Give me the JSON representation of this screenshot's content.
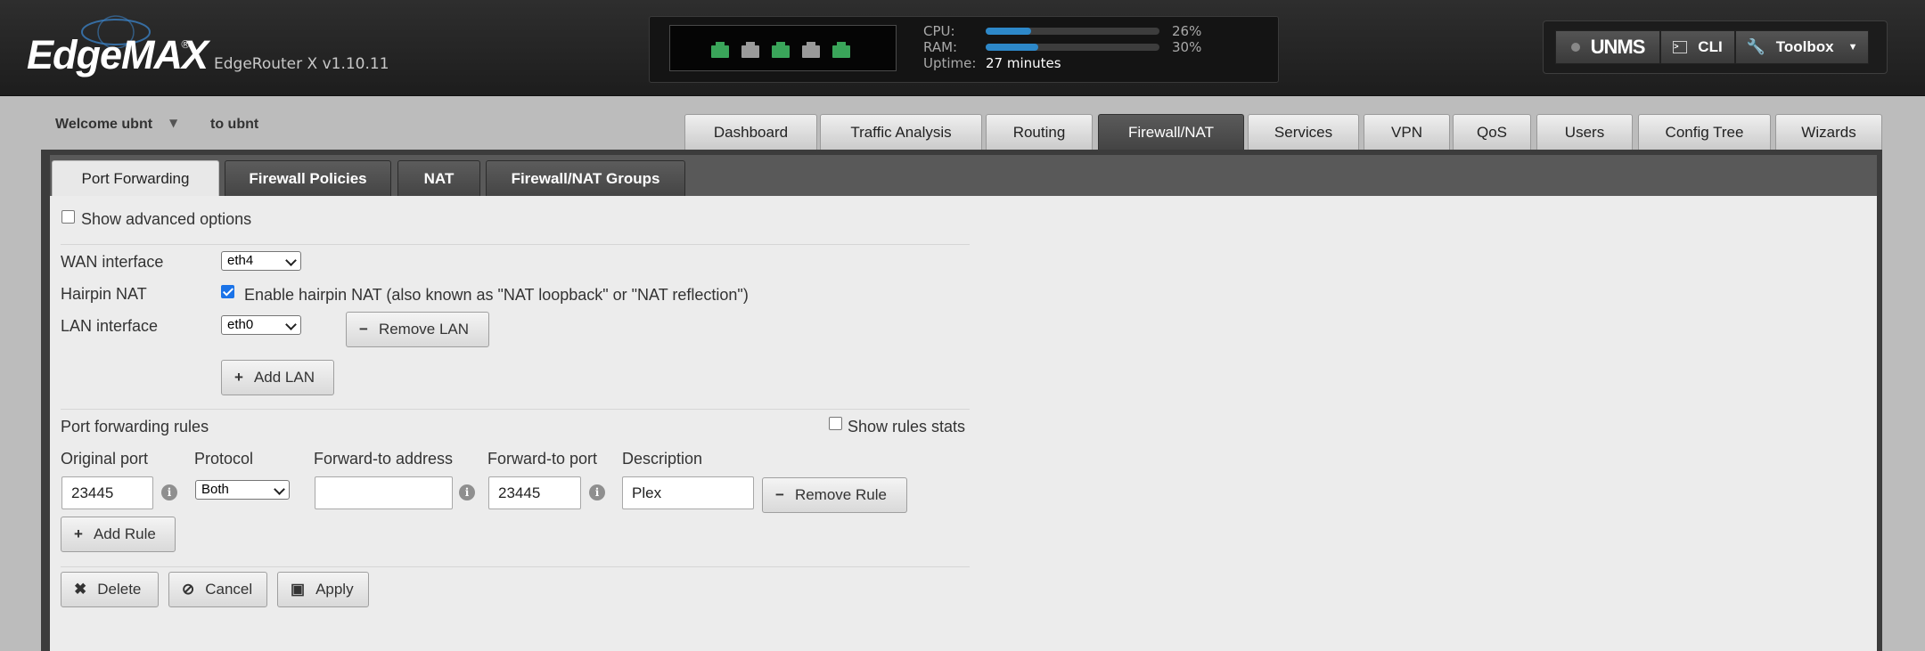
{
  "header": {
    "logo": "EdgeMAX",
    "logo_tm": "®",
    "version": "EdgeRouter X v1.10.11",
    "ports": [
      {
        "name": "port-0",
        "color": "#3aa55a"
      },
      {
        "name": "port-1",
        "color": "#9a9a9a"
      },
      {
        "name": "port-2",
        "color": "#3aa55a"
      },
      {
        "name": "port-3",
        "color": "#9a9a9a"
      },
      {
        "name": "port-4",
        "color": "#3aa55a"
      }
    ],
    "cpu_label": "CPU:",
    "cpu_value": "26%",
    "cpu_fraction": 0.26,
    "ram_label": "RAM:",
    "ram_value": "30%",
    "ram_fraction": 0.3,
    "uptime_label": "Uptime:",
    "uptime_value": "27 minutes",
    "unms_label": "UNMS",
    "cli_label": "CLI",
    "toolbox_label": "Toolbox"
  },
  "user": {
    "welcome": "Welcome ubnt",
    "to_user": "to ubnt"
  },
  "nav": {
    "tabs": [
      "Dashboard",
      "Traffic Analysis",
      "Routing",
      "Firewall/NAT",
      "Services",
      "VPN",
      "QoS",
      "Users",
      "Config Tree",
      "Wizards"
    ],
    "active": "Firewall/NAT"
  },
  "subnav": {
    "tabs": [
      "Port Forwarding",
      "Firewall Policies",
      "NAT",
      "Firewall/NAT Groups"
    ],
    "active": "Port Forwarding"
  },
  "form": {
    "show_advanced": "Show advanced options",
    "wan_label": "WAN interface",
    "wan_value": "eth4",
    "hairpin_label": "Hairpin NAT",
    "hairpin_text": "Enable hairpin NAT (also known as \"NAT loopback\" or \"NAT reflection\")",
    "hairpin_checked": true,
    "lan_label": "LAN interface",
    "lan_value": "eth0",
    "remove_lan": "Remove LAN",
    "add_lan": "Add LAN",
    "rules_label": "Port forwarding rules",
    "show_rules_stats": "Show rules stats",
    "col_original_port": "Original port",
    "col_protocol": "Protocol",
    "col_forward_address": "Forward-to address",
    "col_forward_port": "Forward-to port",
    "col_description": "Description",
    "rule": {
      "original_port": "23445",
      "protocol": "Both",
      "forward_address": "",
      "forward_port": "23445",
      "description": "Plex"
    },
    "remove_rule": "Remove Rule",
    "add_rule": "Add Rule",
    "delete": "Delete",
    "cancel": "Cancel",
    "apply": "Apply"
  }
}
